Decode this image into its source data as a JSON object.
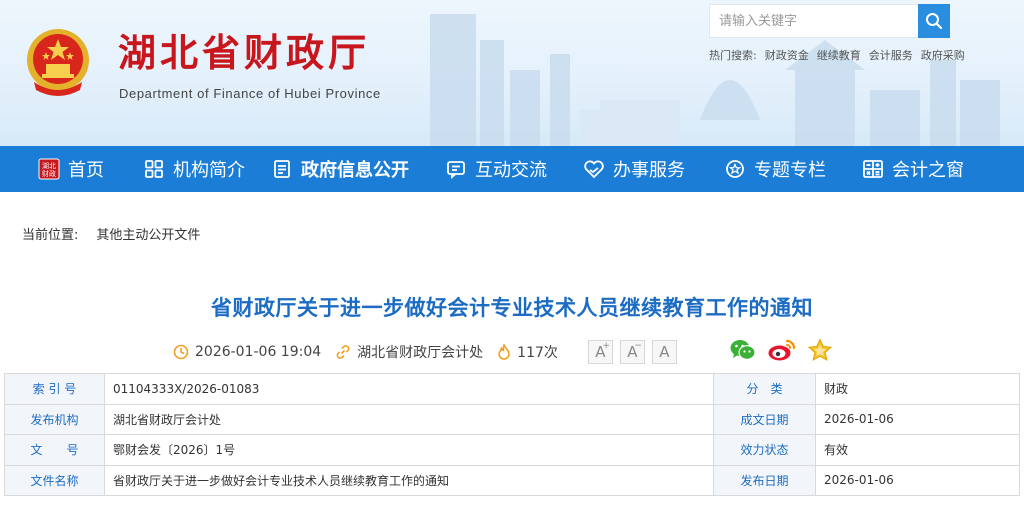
{
  "header": {
    "title": "湖北省财政厅",
    "subtitle": "Department of Finance of Hubei Province",
    "emblem_icon": "national-emblem-icon",
    "search": {
      "placeholder": "请输入关键字"
    },
    "hot_label": "热门搜索:",
    "hot_items": [
      "财政资金",
      "继续教育",
      "会计服务",
      "政府采购"
    ]
  },
  "nav": {
    "items": [
      {
        "label": "首页",
        "icon": "hubei-finance-seal-icon"
      },
      {
        "label": "机构简介",
        "icon": "grid-icon"
      },
      {
        "label": "政府信息公开",
        "icon": "document-icon"
      },
      {
        "label": "互动交流",
        "icon": "chat-icon"
      },
      {
        "label": "办事服务",
        "icon": "heart-hand-icon"
      },
      {
        "label": "专题专栏",
        "icon": "star-circle-icon"
      },
      {
        "label": "会计之窗",
        "icon": "calculator-icon"
      }
    ],
    "active_index": 2,
    "color": "#1b7dd6"
  },
  "breadcrumb": {
    "label": "当前位置:",
    "path": "其他主动公开文件"
  },
  "article": {
    "title": "省财政厅关于进一步做好会计专业技术人员继续教育工作的通知",
    "datetime": "2026-01-06 19:04",
    "source": "湖北省财政厅会计处",
    "views": "117次",
    "font_buttons": [
      "A",
      "A",
      "A"
    ],
    "share_icons": [
      "wechat-icon",
      "weibo-icon",
      "favorite-star-icon"
    ]
  },
  "info_table": {
    "index_label": "索 引 号",
    "index_value": "01104333X/2026-01083",
    "category_label": "分　类",
    "category_value": "财政",
    "publisher_label": "发布机构",
    "publisher_value": "湖北省财政厅会计处",
    "created_label": "成文日期",
    "created_value": "2026-01-06",
    "docno_label": "文　　号",
    "docno_value": "鄂财会发〔2026〕1号",
    "status_label": "效力状态",
    "status_value": "有效",
    "filename_label": "文件名称",
    "filename_value": "省财政厅关于进一步做好会计专业技术人员继续教育工作的通知",
    "pubdate_label": "发布日期",
    "pubdate_value": "2026-01-06"
  },
  "colors": {
    "brand_red": "#c8161d",
    "title_blue": "#1d6cc4",
    "accent_orange": "#f0a020"
  }
}
